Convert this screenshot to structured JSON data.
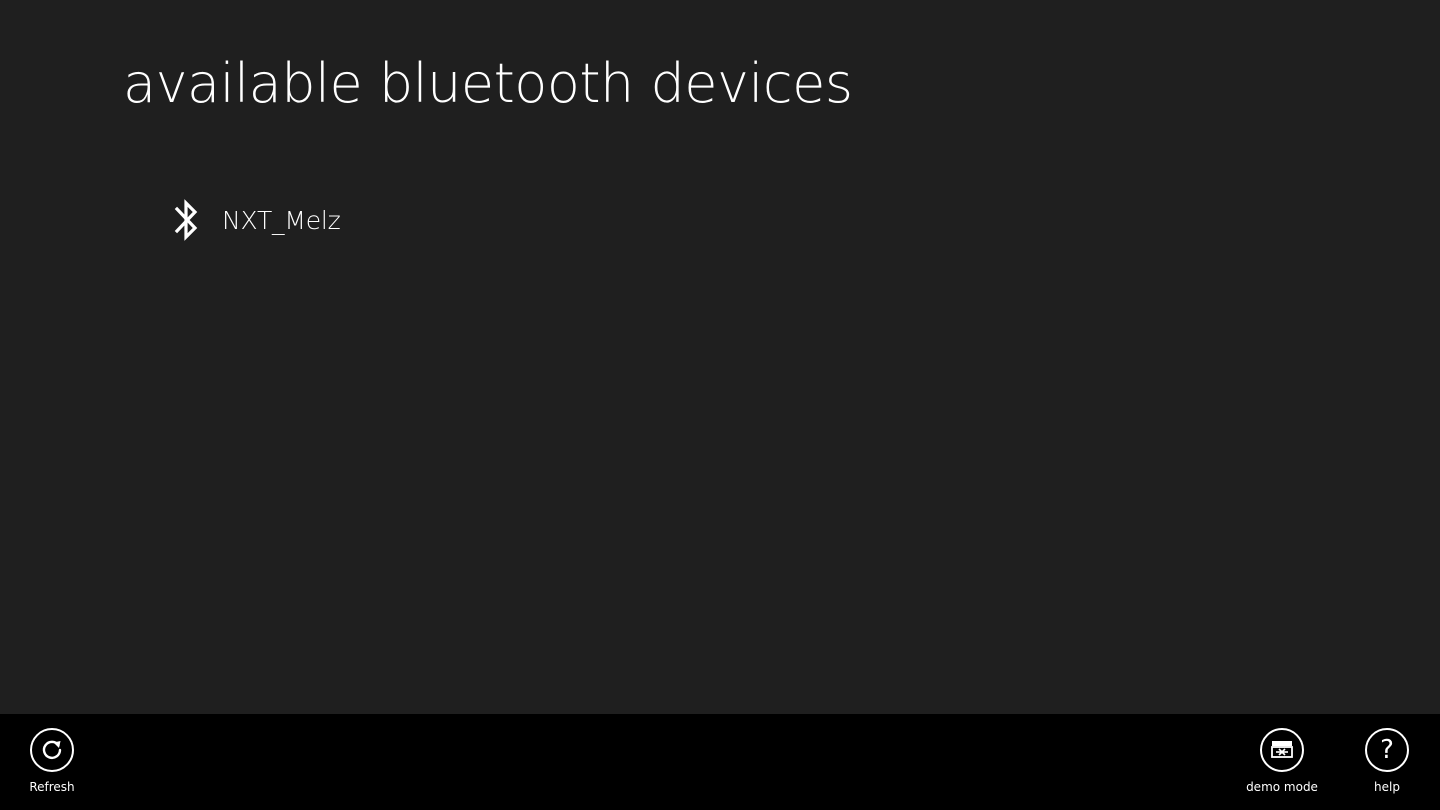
{
  "page": {
    "title": "available bluetooth devices"
  },
  "devices": [
    {
      "name": "NXT_Melz",
      "icon": "bluetooth-icon"
    }
  ],
  "app_bar": {
    "refresh_label": "Refresh",
    "demo_mode_label": "demo mode",
    "help_label": "help",
    "help_glyph": "?"
  },
  "colors": {
    "background": "#1f1f1f",
    "app_bar_background": "#000000",
    "foreground": "#ffffff"
  }
}
